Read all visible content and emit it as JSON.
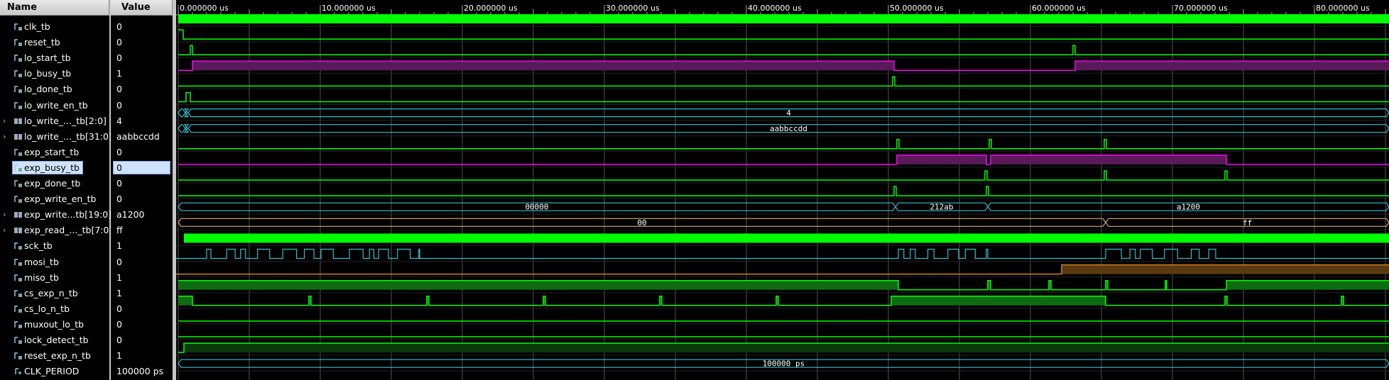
{
  "header": {
    "name": "Name",
    "value": "Value"
  },
  "ruler": {
    "unit": "us",
    "major_ticks": [
      "0.000000 us",
      "10.000000 us",
      "20.000000 us",
      "30.000000 us",
      "40.000000 us",
      "50.000000 us",
      "60.000000 us",
      "70.000000 us",
      "80.000000 us"
    ]
  },
  "colors": {
    "digital_high": "#00ff00",
    "busy": "#ff00ff",
    "bus": "#30c0d0",
    "bus_fill": "#0a3d44",
    "cs_fill": "#0f6b12",
    "miso": "#d08020",
    "grid": "#555555",
    "selection": "#cfe2fb"
  },
  "signals": [
    {
      "name": "clk_tb",
      "value": "0",
      "type": "bit"
    },
    {
      "name": "reset_tb",
      "value": "0",
      "type": "bit"
    },
    {
      "name": "lo_start_tb",
      "value": "0",
      "type": "bit"
    },
    {
      "name": "lo_busy_tb",
      "value": "1",
      "type": "bit"
    },
    {
      "name": "lo_done_tb",
      "value": "0",
      "type": "bit"
    },
    {
      "name": "lo_write_en_tb",
      "value": "0",
      "type": "bit"
    },
    {
      "name": "lo_write_..._tb[2:0]",
      "value": "4",
      "type": "bus",
      "label": "4"
    },
    {
      "name": "lo_write_..._tb[31:0]",
      "value": "aabbccdd",
      "type": "bus",
      "label": "aabbccdd"
    },
    {
      "name": "exp_start_tb",
      "value": "0",
      "type": "bit"
    },
    {
      "name": "exp_busy_tb",
      "value": "0",
      "type": "bit",
      "selected": true
    },
    {
      "name": "exp_done_tb",
      "value": "0",
      "type": "bit"
    },
    {
      "name": "exp_write_en_tb",
      "value": "0",
      "type": "bit"
    },
    {
      "name": "exp_write...tb[19:0]",
      "value": "a1200",
      "type": "bus",
      "segments": [
        "00000",
        "212ab",
        "a1200"
      ]
    },
    {
      "name": "exp_read_..._tb[7:0]",
      "value": "ff",
      "type": "bus",
      "segments": [
        "00",
        "ff"
      ]
    },
    {
      "name": "sck_tb",
      "value": "1",
      "type": "bit"
    },
    {
      "name": "mosi_tb",
      "value": "0",
      "type": "bit"
    },
    {
      "name": "miso_tb",
      "value": "1",
      "type": "bit"
    },
    {
      "name": "cs_exp_n_tb",
      "value": "1",
      "type": "bit"
    },
    {
      "name": "cs_lo_n_tb",
      "value": "0",
      "type": "bit"
    },
    {
      "name": "muxout_lo_tb",
      "value": "0",
      "type": "bit"
    },
    {
      "name": "lock_detect_tb",
      "value": "0",
      "type": "bit"
    },
    {
      "name": "reset_exp_n_tb",
      "value": "1",
      "type": "bit"
    },
    {
      "name": "CLK_PERIOD",
      "value": "100000 ps",
      "type": "param",
      "label": "100000 ps"
    }
  ]
}
